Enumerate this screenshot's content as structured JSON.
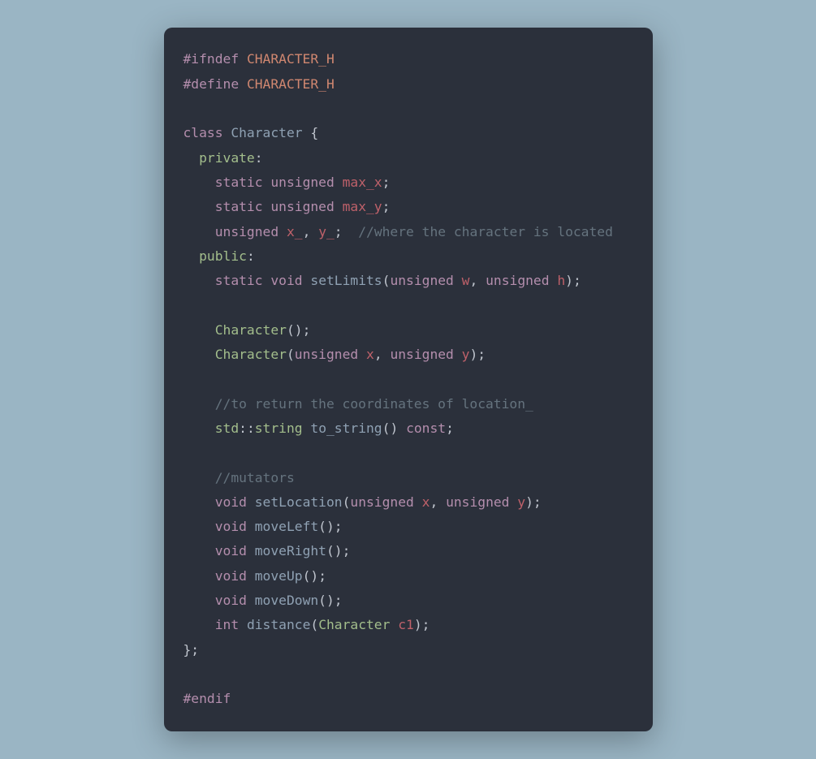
{
  "code": {
    "ifndef": "#ifndef",
    "define": "#define",
    "endif": "#endif",
    "guard": "CHARACTER_H",
    "class_kw": "class",
    "classname": "Character",
    "lbrace": " {",
    "private": "private",
    "public": "public",
    "colon": ":",
    "static": "static",
    "unsigned": "unsigned",
    "void": "void",
    "int": "int",
    "const": "const",
    "std": "std",
    "scopeop": "::",
    "string_t": "string",
    "max_x": "max_x",
    "max_y": "max_y",
    "x_": "x_",
    "y_": "y_",
    "w": "w",
    "h": "h",
    "x": "x",
    "y": "y",
    "c1": "c1",
    "setLimits": "setLimits",
    "Character_ctor": "Character",
    "to_string": "to_string",
    "setLocation": "setLocation",
    "moveLeft": "moveLeft",
    "moveRight": "moveRight",
    "moveUp": "moveUp",
    "moveDown": "moveDown",
    "distance": "distance",
    "semisc": ";",
    "comma": ",",
    "lparen": "(",
    "rparen": ")",
    "rbrace_semi": "};",
    "comment_loc": "//where the character is located",
    "comment_ret": "//to return the coordinates of location_",
    "comment_mut": "//mutators"
  }
}
